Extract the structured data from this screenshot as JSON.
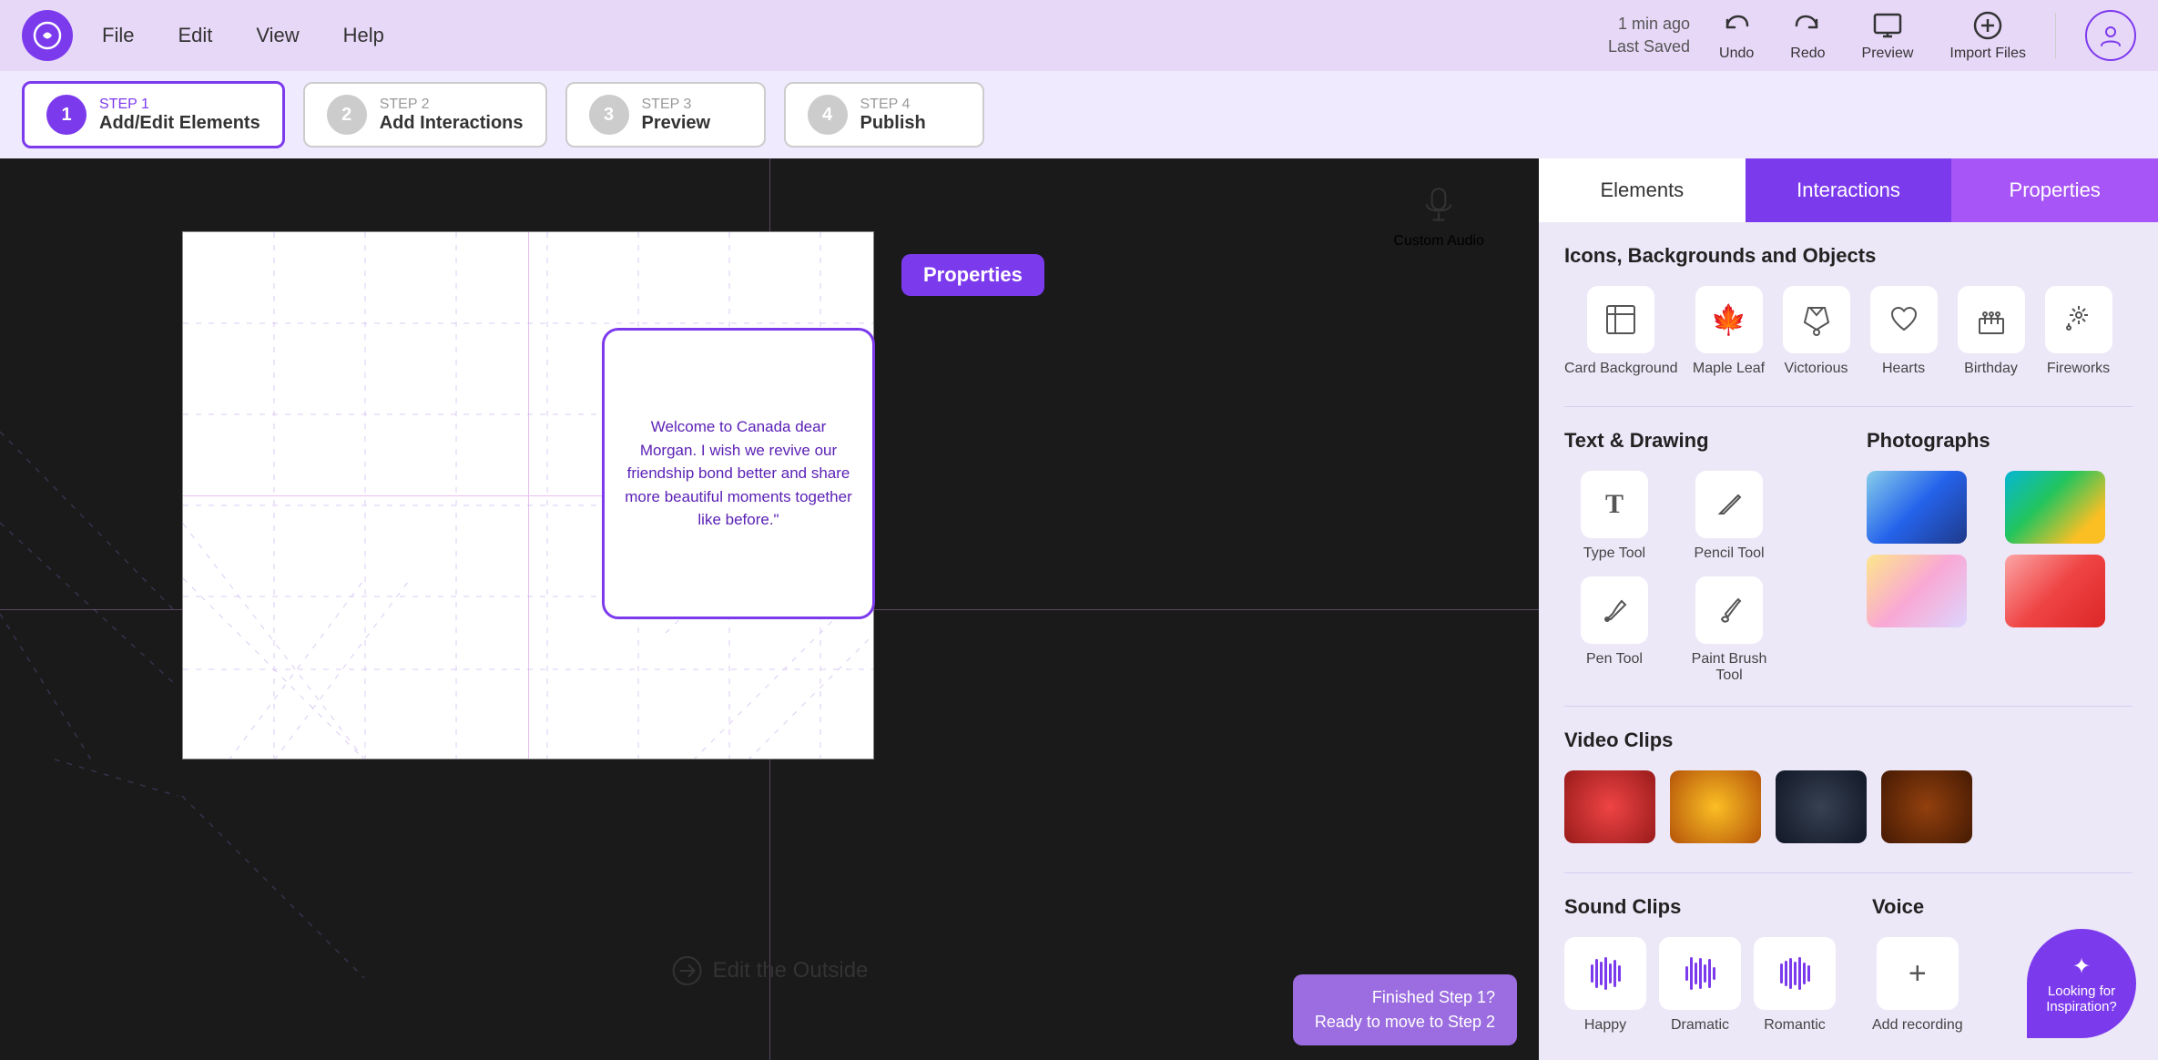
{
  "app": {
    "logo_icon": "⊕",
    "nav_items": [
      "File",
      "Edit",
      "View",
      "Help"
    ],
    "save_time": "1 min ago",
    "save_label": "Last Saved",
    "toolbar": {
      "undo": "Undo",
      "redo": "Redo",
      "preview": "Preview",
      "import": "Import Files"
    }
  },
  "steps": [
    {
      "num": "1",
      "label": "STEP 1",
      "name": "Add/Edit Elements",
      "active": true
    },
    {
      "num": "2",
      "label": "STEP 2",
      "name": "Add Interactions",
      "active": false
    },
    {
      "num": "3",
      "label": "STEP 3",
      "name": "Preview",
      "active": false
    },
    {
      "num": "4",
      "label": "STEP 4",
      "name": "Publish",
      "active": false
    }
  ],
  "canvas": {
    "card_text": "Welcome to Canada dear Morgan. I wish we revive our friendship bond better and share more beautiful moments together like before.\"",
    "properties_btn": "Properties",
    "custom_audio_label": "Custom Audio",
    "edit_outside_label": "Edit the Outside",
    "finished_step_line1": "Finished Step 1?",
    "finished_step_line2": "Ready to move to Step 2"
  },
  "panel": {
    "tabs": [
      {
        "label": "Elements",
        "state": "active-elements"
      },
      {
        "label": "Interactions",
        "state": "active-interactions"
      },
      {
        "label": "Properties",
        "state": "active-properties"
      }
    ],
    "sections": {
      "icons_title": "Icons, Backgrounds and Objects",
      "icons": [
        {
          "label": "Card Background",
          "icon": "⊞"
        },
        {
          "label": "Maple Leaf",
          "icon": "🍁"
        },
        {
          "label": "Victorious",
          "icon": "🏆"
        },
        {
          "label": "Hearts",
          "icon": "♡"
        },
        {
          "label": "Birthday",
          "icon": "🎂"
        },
        {
          "label": "Fireworks",
          "icon": "✨"
        }
      ],
      "text_drawing_title": "Text & Drawing",
      "tools": [
        {
          "label": "Type Tool",
          "icon": "T"
        },
        {
          "label": "Pencil Tool",
          "icon": "✏"
        },
        {
          "label": "Pen Tool",
          "icon": "🖊"
        },
        {
          "label": "Paint Brush Tool",
          "icon": "🖌"
        }
      ],
      "photographs_title": "Photographs",
      "video_clips_title": "Video Clips",
      "sound_clips_title": "Sound Clips",
      "voice_title": "Voice",
      "sounds": [
        {
          "label": "Happy"
        },
        {
          "label": "Dramatic"
        },
        {
          "label": "Romantic"
        }
      ],
      "add_recording_label": "Add recording",
      "inspiration_label": "Looking for Inspiration?"
    }
  }
}
